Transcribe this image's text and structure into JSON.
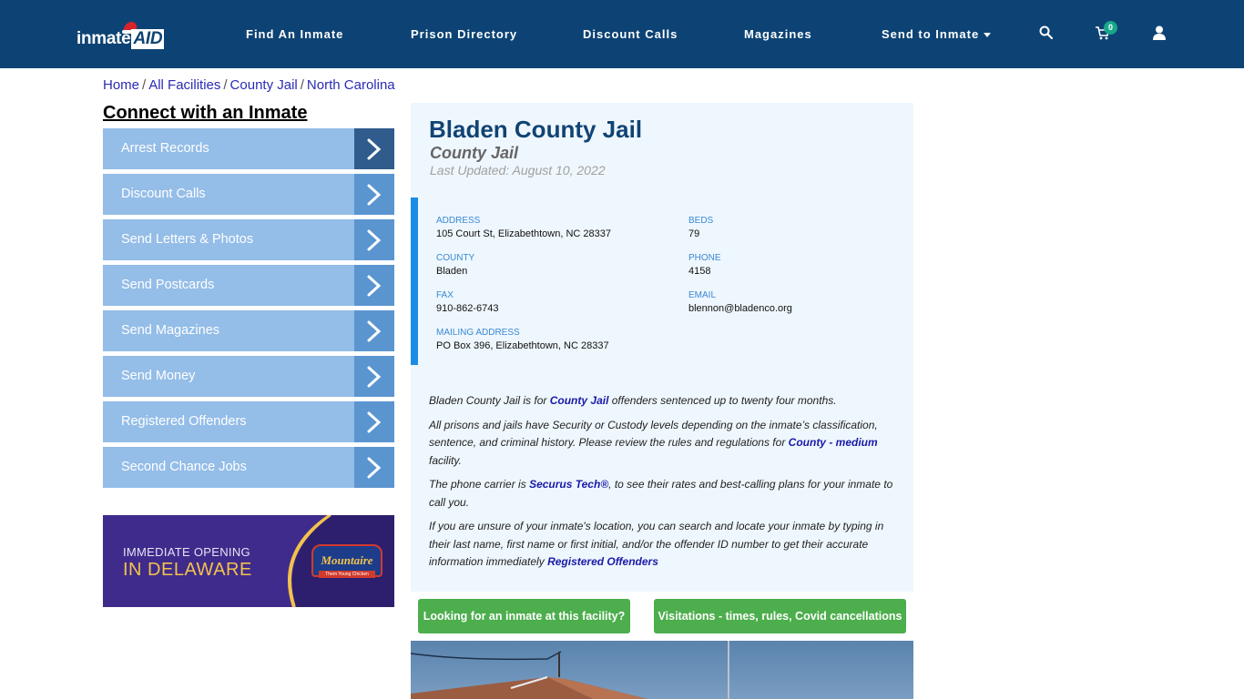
{
  "header": {
    "logo_text": "inmate",
    "logo_accent": "AID",
    "nav": [
      {
        "label": "Find An Inmate"
      },
      {
        "label": "Prison Directory"
      },
      {
        "label": "Discount Calls"
      },
      {
        "label": "Magazines"
      },
      {
        "label": "Send to Inmate",
        "has_dropdown": true
      }
    ],
    "icons": [
      "search-icon",
      "cart-icon",
      "user-icon"
    ],
    "cart_count": "0",
    "colors": {
      "bar": "#0d4374",
      "badge": "#17a789"
    }
  },
  "breadcrumb": [
    {
      "label": "Home"
    },
    {
      "label": "All Facilities"
    },
    {
      "label": "County Jail"
    },
    {
      "label": "North Carolina"
    }
  ],
  "sidebar": {
    "title": "Connect with an Inmate",
    "items": [
      {
        "label": "Arrest Records",
        "active": true
      },
      {
        "label": "Discount Calls"
      },
      {
        "label": "Send Letters & Photos"
      },
      {
        "label": "Send Postcards"
      },
      {
        "label": "Send Magazines"
      },
      {
        "label": "Send Money"
      },
      {
        "label": "Registered Offenders"
      },
      {
        "label": "Second Chance Jobs"
      }
    ],
    "ad": {
      "line1": "IMMEDIATE OPENING",
      "line2": "IN DELAWARE",
      "brand": "Mountaire",
      "brand_sub": "Them Young Chicken"
    }
  },
  "facility": {
    "name": "Bladen County Jail",
    "type": "County Jail",
    "last_updated": "Last Updated: August 10, 2022",
    "fields": {
      "address": {
        "label": "ADDRESS",
        "value": "105 Court St, Elizabethtown, NC 28337"
      },
      "beds": {
        "label": "BEDS",
        "value": "79"
      },
      "county": {
        "label": "COUNTY",
        "value": "Bladen"
      },
      "phone": {
        "label": "PHONE",
        "value": "4158"
      },
      "fax": {
        "label": "FAX",
        "value": "910-862-6743"
      },
      "email": {
        "label": "EMAIL",
        "value": "blennon@bladenco.org"
      },
      "mailing": {
        "label": "MAILING ADDRESS",
        "value": "PO Box 396, Elizabethtown, NC 28337"
      }
    },
    "description": {
      "p1_a": "Bladen County Jail is for ",
      "p1_link": "County Jail",
      "p1_b": " offenders sentenced up to twenty four months.",
      "p2_a": "All prisons and jails have Security or Custody levels depending on the inmate’s classification, sentence, and criminal history. Please review the rules and regulations for ",
      "p2_link": "County - medium",
      "p2_b": " facility.",
      "p3_a": "The phone carrier is ",
      "p3_link": "Securus Tech®",
      "p3_b": ", to see their rates and best-calling plans for your inmate to call you.",
      "p4_a": "If you are unsure of your inmate's location, you can search and locate your inmate by typing in their last name, first name or first initial, and/or the offender ID number to get their accurate information immediately ",
      "p4_link": "Registered Offenders"
    }
  },
  "buttons": {
    "find_inmate": "Looking for an inmate at this facility?",
    "visitation": "Visitations - times, rules, Covid cancellations"
  }
}
